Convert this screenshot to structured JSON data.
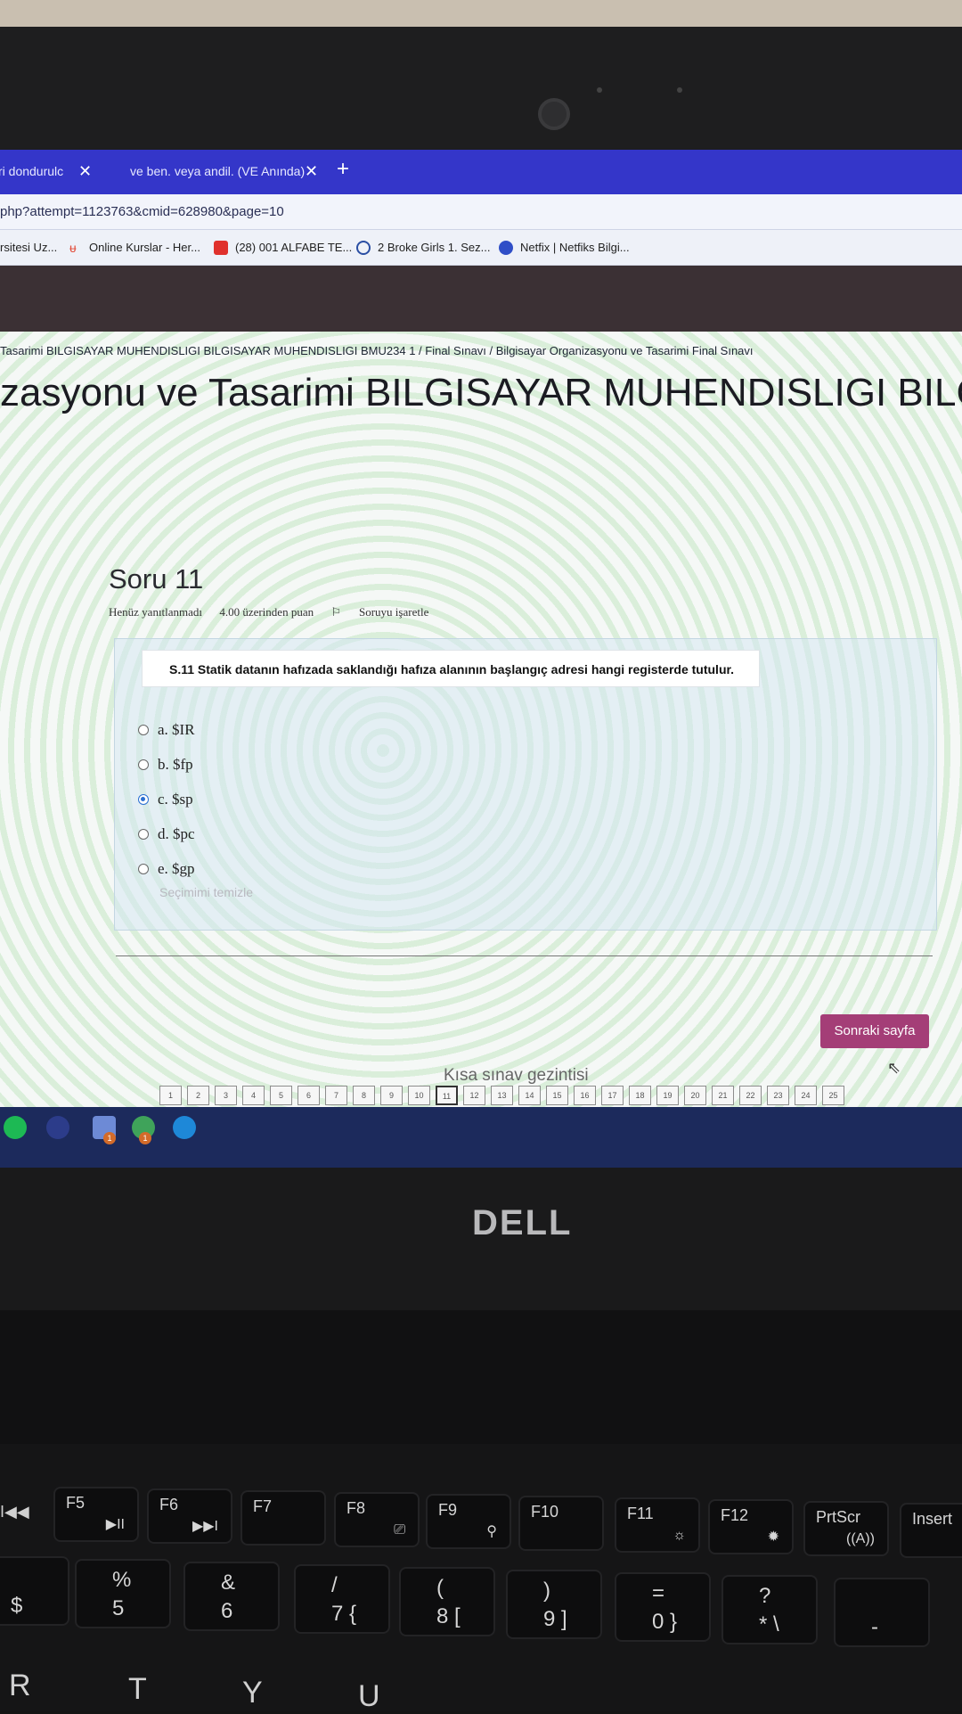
{
  "browser": {
    "tabs": [
      {
        "title": "ri dondurulc",
        "close": "✕"
      },
      {
        "title": "ve ben. veya andil. (VE Anında)",
        "close": "✕"
      }
    ],
    "new_tab": "+",
    "url": "php?attempt=1123763&cmid=628980&page=10",
    "bookmarks": [
      "rsitesi Uz...",
      "Online Kurslar - Her...",
      "(28) 001 ALFABE TE...",
      "2 Broke Girls 1. Sez...",
      "Netfix | Netfiks Bilgi..."
    ]
  },
  "page": {
    "breadcrumb": "Tasarimi BILGISAYAR MUHENDISLIGI BILGISAYAR MUHENDISLIGI BMU234 1  /  Final Sınavı  /  Bilgisayar Organizasyonu ve Tasarimi Final Sınavı",
    "title": "zasyonu ve Tasarimi BILGISAYAR MUHENDISLIGI BILGISA"
  },
  "question": {
    "heading": "Soru 11",
    "status": "Henüz yanıtlanmadı",
    "points": "4.00 üzerinden puan",
    "flag_label": "Soruyu işaretle",
    "text": "S.11 Statik datanın hafızada saklandığı hafıza alanının başlangıç adresi hangi registerde tutulur.",
    "options": [
      {
        "label": "a. $IR",
        "checked": false
      },
      {
        "label": "b. $fp",
        "checked": false
      },
      {
        "label": "c. $sp",
        "checked": true
      },
      {
        "label": "d. $pc",
        "checked": false
      },
      {
        "label": "e. $gp",
        "checked": false
      }
    ],
    "clear_choice": "Seçimimi temizle"
  },
  "navigation": {
    "next_button": "Sonraki sayfa",
    "quiz_nav_title": "Kısa sınav gezintisi",
    "pages": [
      "1",
      "2",
      "3",
      "4",
      "5",
      "6",
      "7",
      "8",
      "9",
      "10",
      "11",
      "12",
      "13",
      "14",
      "15",
      "16",
      "17",
      "18",
      "19",
      "20",
      "21",
      "22",
      "23",
      "24",
      "25"
    ],
    "current_page": "11"
  },
  "taskbar": {
    "badges": [
      "1",
      "1"
    ]
  },
  "laptop": {
    "brand": "DELL",
    "fkeys": [
      {
        "label": "F5",
        "glyph": "▶II"
      },
      {
        "label": "F6",
        "glyph": "▶▶I"
      },
      {
        "label": "F7",
        "glyph": ""
      },
      {
        "label": "F8",
        "glyph": "⎚"
      },
      {
        "label": "F9",
        "glyph": "⚲"
      },
      {
        "label": "F10",
        "glyph": ""
      },
      {
        "label": "F11",
        "glyph": "☼"
      },
      {
        "label": "F12",
        "glyph": "✹"
      },
      {
        "label": "PrtScr",
        "glyph": "((A))"
      },
      {
        "label": "Insert",
        "glyph": ""
      }
    ],
    "numkeys": [
      {
        "top": "",
        "bottom": "$"
      },
      {
        "top": "%",
        "bottom": "5"
      },
      {
        "top": "&",
        "bottom": "6"
      },
      {
        "top": "/",
        "bottom": "7  {"
      },
      {
        "top": "(",
        "bottom": "8  ["
      },
      {
        "top": ")",
        "bottom": "9  ]"
      },
      {
        "top": "=",
        "bottom": "0  }"
      },
      {
        "top": "?",
        "bottom": "*  \\"
      },
      {
        "top": "",
        "bottom": "-"
      }
    ],
    "letterkeys": [
      "R",
      "T",
      "Y",
      "U"
    ],
    "media_glyph": "I◀◀"
  }
}
